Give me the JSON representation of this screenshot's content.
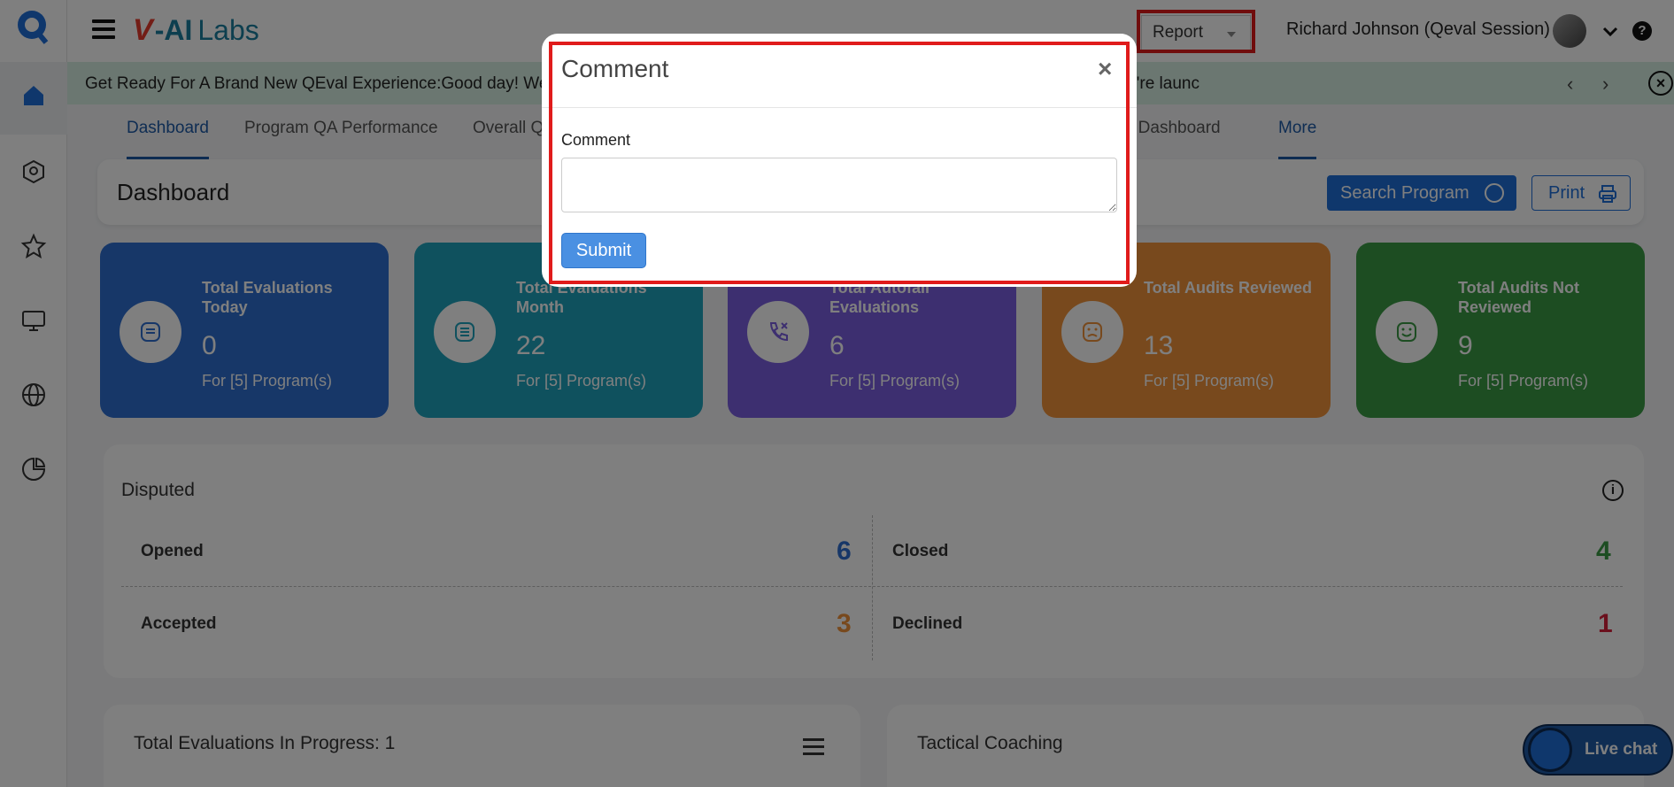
{
  "topbar": {
    "brand_v": "V",
    "brand_ai": "-AI",
    "brand_labs": "Labs",
    "report_label": "Report",
    "user_name": "Richard Johnson (Qeval Session)",
    "help_label": "?"
  },
  "announcement": {
    "text": "Get Ready For A Brand New QEval Experience:Good day! We",
    "text_tail": "we're launc"
  },
  "tabs": [
    {
      "label": "Dashboard"
    },
    {
      "label": "Program QA Performance"
    },
    {
      "label": "Overall Q"
    },
    {
      "label": "ser Dashboard"
    },
    {
      "label": "More"
    }
  ],
  "dashboard": {
    "title": "Dashboard",
    "search_label": "Search Program",
    "print_label": "Print"
  },
  "cards": [
    {
      "label": "Total Evaluations Today",
      "value": "0",
      "sub": "For [5] Program(s)",
      "color": "#2e6fd0"
    },
    {
      "label": "Total Evaluations Month",
      "value": "22",
      "sub": "For [5] Program(s)",
      "color": "#1fa3bd"
    },
    {
      "label": "Total Autofail Evaluations",
      "value": "6",
      "sub": "For [5] Program(s)",
      "color": "#7b5fe0"
    },
    {
      "label": "Total Audits Reviewed",
      "value": "13",
      "sub": "For [5] Program(s)",
      "color": "#f0923a"
    },
    {
      "label": "Total Audits Not Reviewed",
      "value": "9",
      "sub": "For [5] Program(s)",
      "color": "#3a9a45"
    }
  ],
  "disputed": {
    "title": "Disputed",
    "opened_label": "Opened",
    "opened_value": "6",
    "closed_label": "Closed",
    "closed_value": "4",
    "accepted_label": "Accepted",
    "accepted_value": "3",
    "declined_label": "Declined",
    "declined_value": "1",
    "info_label": "i"
  },
  "bottom": {
    "progress_title": "Total Evaluations In Progress: 1",
    "coaching_title": "Tactical Coaching"
  },
  "livechat": {
    "label": "Live chat"
  },
  "modal": {
    "title": "Comment",
    "close": "×",
    "field_label": "Comment",
    "field_value": "",
    "submit_label": "Submit"
  }
}
